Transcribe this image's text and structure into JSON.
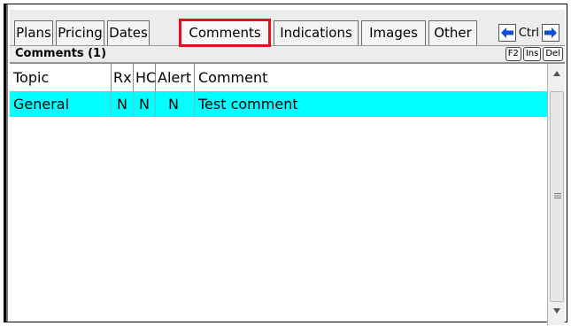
{
  "tabs": [
    {
      "label": "Plans"
    },
    {
      "label": "Pricing"
    },
    {
      "label": "Dates"
    },
    {
      "label": "Comments"
    },
    {
      "label": "Indications"
    },
    {
      "label": "Images"
    },
    {
      "label": "Other"
    }
  ],
  "nav": {
    "ctrl_label": "Ctrl"
  },
  "section": {
    "title": "Comments (1)",
    "keys": [
      "F2",
      "Ins",
      "Del"
    ]
  },
  "grid": {
    "columns": [
      "Topic",
      "Rx",
      "HC",
      "Alert",
      "Comment"
    ],
    "rows": [
      {
        "topic": "General",
        "rx": "N",
        "hc": "N",
        "alert": "N",
        "comment": "Test comment"
      }
    ]
  },
  "colors": {
    "accent": "#e0101e",
    "selected_row": "#00ffff",
    "nav_arrow": "#0a4fd6"
  }
}
